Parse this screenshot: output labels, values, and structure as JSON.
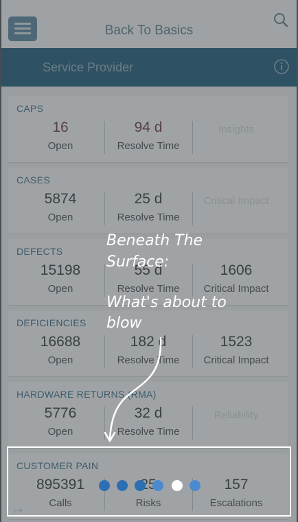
{
  "header": {
    "title": "Back To Basics"
  },
  "subheader": {
    "title": "Service Provider"
  },
  "cards": [
    {
      "title": "CAPS",
      "metrics": [
        {
          "value": "16",
          "label": "Open"
        },
        {
          "value": "94 d",
          "label": "Resolve Time"
        },
        {
          "value": "",
          "label": "Insights"
        }
      ]
    },
    {
      "title": "CASES",
      "metrics": [
        {
          "value": "5874",
          "label": "Open"
        },
        {
          "value": "25 d",
          "label": "Resolve Time"
        },
        {
          "value": "",
          "label": "Critical Impact"
        }
      ]
    },
    {
      "title": "DEFECTS",
      "metrics": [
        {
          "value": "15198",
          "label": "Open"
        },
        {
          "value": "55 d",
          "label": "Resolve Time"
        },
        {
          "value": "1606",
          "label": "Critical Impact"
        }
      ]
    },
    {
      "title": "DEFICIENCIES",
      "metrics": [
        {
          "value": "16688",
          "label": "Open"
        },
        {
          "value": "182 d",
          "label": "Resolve Time"
        },
        {
          "value": "1523",
          "label": "Critical Impact"
        }
      ]
    },
    {
      "title": "HARDWARE RETURNS (RMA)",
      "metrics": [
        {
          "value": "5776",
          "label": "Open"
        },
        {
          "value": "32 d",
          "label": "Resolve Time"
        },
        {
          "value": "",
          "label": "Reliability"
        }
      ]
    },
    {
      "title": "CUSTOMER PAIN",
      "metrics": [
        {
          "value": "895391",
          "label": "Calls"
        },
        {
          "value": "25",
          "label": "Risks"
        },
        {
          "value": "157",
          "label": "Escalations"
        }
      ]
    }
  ],
  "overlay": {
    "line1": "Beneath The",
    "line2": "Surface:",
    "line3": "What's about to",
    "line4": "blow"
  },
  "pager": {
    "total": 6,
    "active_index": 4
  },
  "colors": {
    "accent": "#356a87",
    "overlay_text": "#ffffff",
    "pager_dot": "#2d6fb3"
  },
  "icons": {
    "menu": "menu-icon",
    "search": "search-icon",
    "info": "info-icon",
    "bottom": "share-icon"
  }
}
